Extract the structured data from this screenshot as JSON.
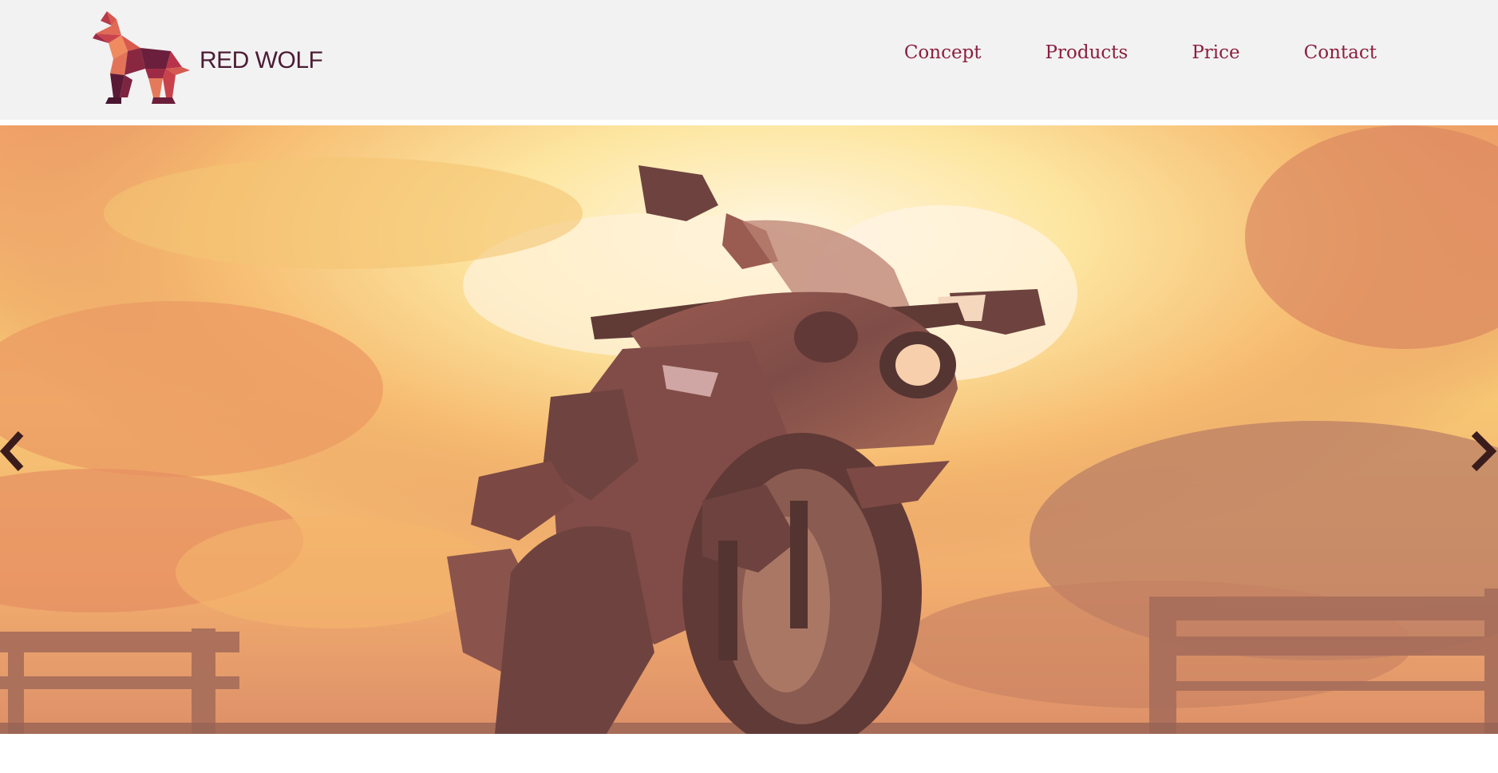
{
  "brand": {
    "name": "RED WOLF",
    "logo_icon": "wolf-logo-icon",
    "text_color": "#4d1c35"
  },
  "nav": {
    "items": [
      {
        "label": "Concept"
      },
      {
        "label": "Products"
      },
      {
        "label": "Price"
      },
      {
        "label": "Contact"
      }
    ],
    "color": "#8c1f3f"
  },
  "hero": {
    "image": "motorcycle-sunset-photo",
    "prev_icon": "chevron-left-icon",
    "next_icon": "chevron-right-icon",
    "arrow_color": "#3a1c1c"
  },
  "colors": {
    "header_bg": "#f2f2f2",
    "page_bg": "#ffffff"
  }
}
